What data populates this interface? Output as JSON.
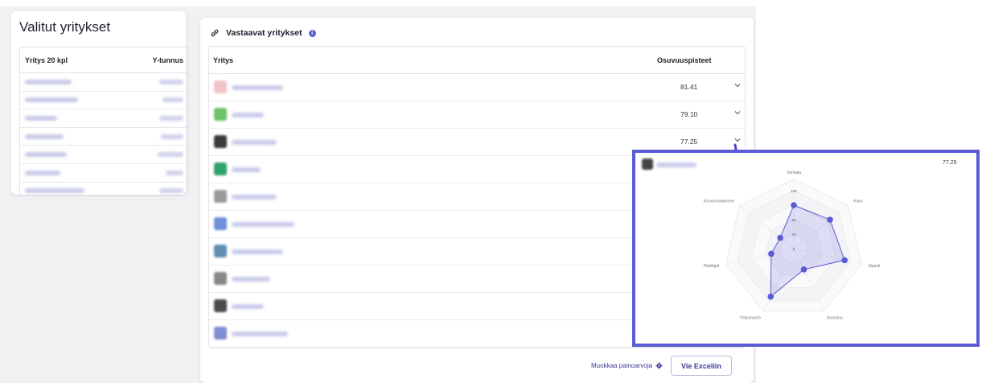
{
  "left_panel": {
    "title": "Valitut yritykset",
    "col_company": "Yritys 20 kpl",
    "col_id": "Y-tunnus",
    "rows": 7
  },
  "main_panel": {
    "title": "Vastaavat yritykset",
    "col_company": "Yritys",
    "col_score": "Osuvuuspisteet",
    "rows": [
      {
        "score": "81.41",
        "logo_color": "#f2c4c9"
      },
      {
        "score": "79.10",
        "logo_color": "#6cc36a"
      },
      {
        "score": "77.25",
        "logo_color": "#3a3a3a"
      },
      {
        "score": "",
        "logo_color": "#2fa36b"
      },
      {
        "score": "",
        "logo_color": "#9a9a9a"
      },
      {
        "score": "",
        "logo_color": "#6f8fd8"
      },
      {
        "score": "",
        "logo_color": "#5e8fb3"
      },
      {
        "score": "",
        "logo_color": "#888888"
      },
      {
        "score": "",
        "logo_color": "#4a4a4a"
      },
      {
        "score": "",
        "logo_color": "#7f8ed0"
      }
    ],
    "edit_weights": "Muokkaa painoarvoja",
    "export_button": "Vie Exceliin"
  },
  "callout": {
    "score": "77.25",
    "radar_axes": [
      "Toimiala",
      "Koko",
      "Sijainti",
      "Arvostus",
      "Yritysmuoto",
      "Päättäjät",
      "Konsernirakenne"
    ],
    "radar_values": [
      75,
      80,
      90,
      40,
      92,
      40,
      30
    ],
    "radar_ticks": [
      "100",
      "75",
      "50",
      "25",
      "0"
    ]
  },
  "colors": {
    "accent": "#5b5bd6",
    "arrow": "#4b44c8"
  }
}
